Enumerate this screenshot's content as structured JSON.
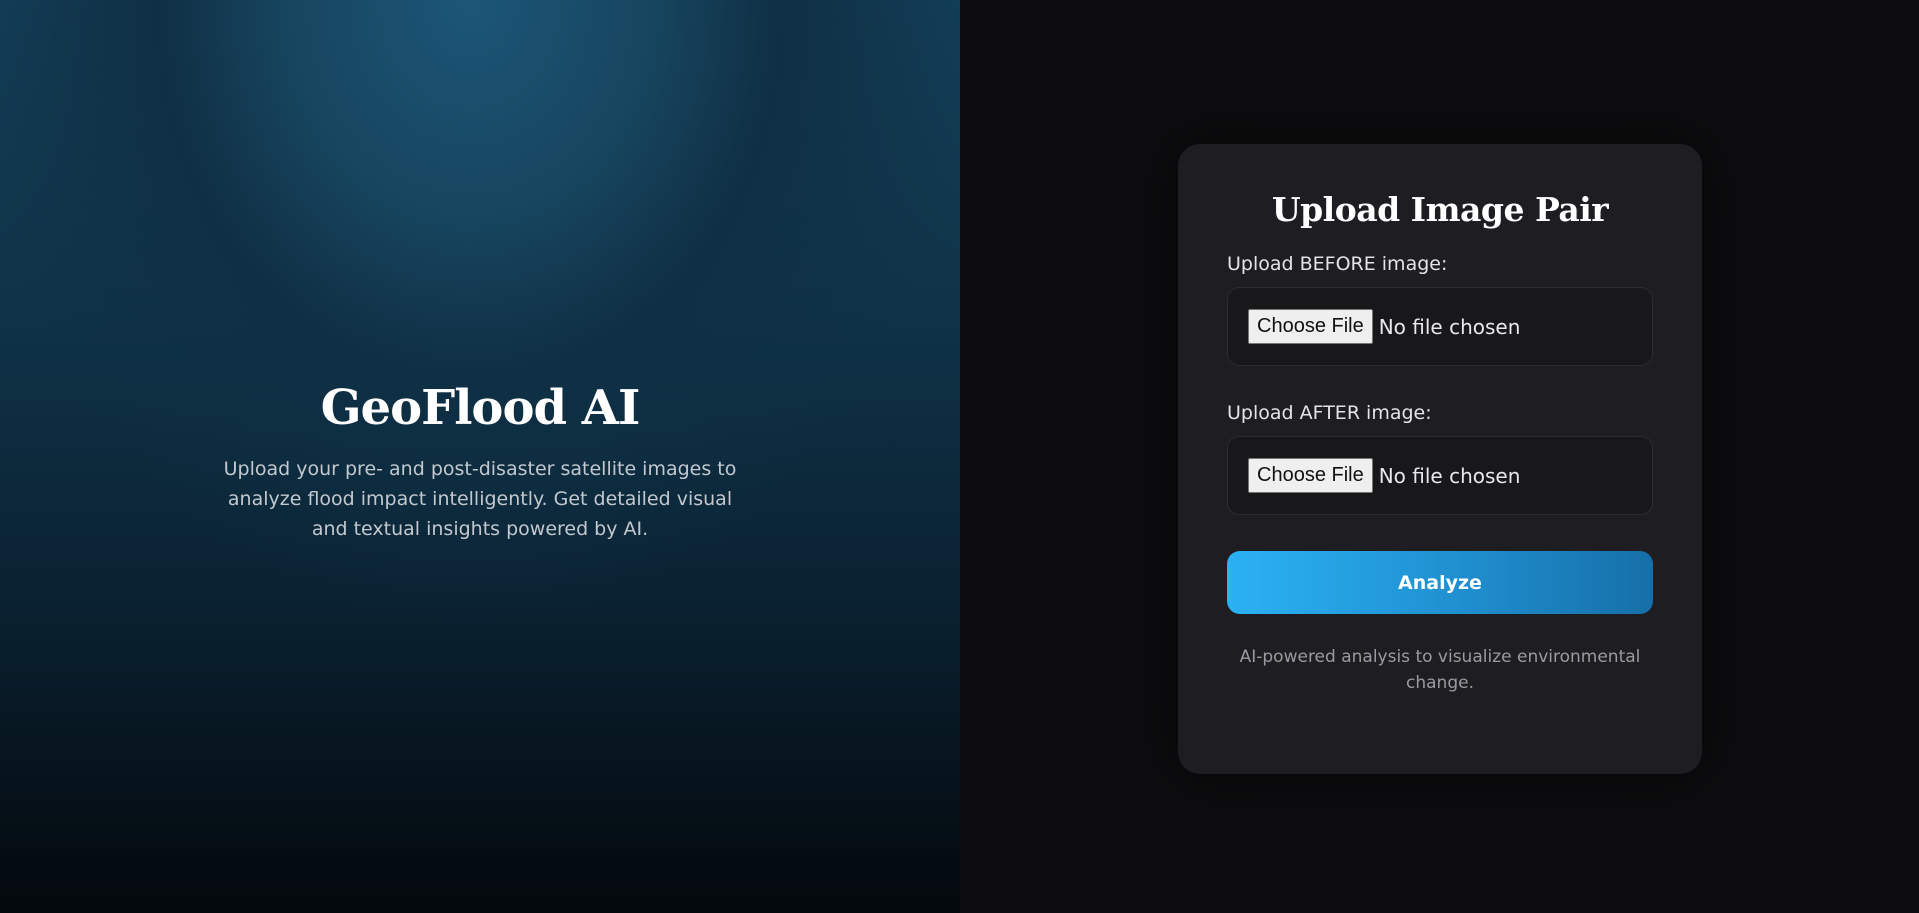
{
  "hero": {
    "title": "GeoFlood AI",
    "description": "Upload your pre- and post-disaster satellite images to analyze flood impact intelligently. Get detailed visual and textual insights powered by AI."
  },
  "card": {
    "title": "Upload Image Pair",
    "before": {
      "label": "Upload BEFORE image:",
      "button": "Choose File",
      "status": "No file chosen"
    },
    "after": {
      "label": "Upload AFTER image:",
      "button": "Choose File",
      "status": "No file chosen"
    },
    "analyze_label": "Analyze",
    "footnote": "AI-powered analysis to visualize environmental change."
  },
  "colors": {
    "accent_start": "#2bb2f4",
    "accent_end": "#166fa8",
    "card_bg": "#1e1e22",
    "page_bg": "#0d0d0f"
  }
}
